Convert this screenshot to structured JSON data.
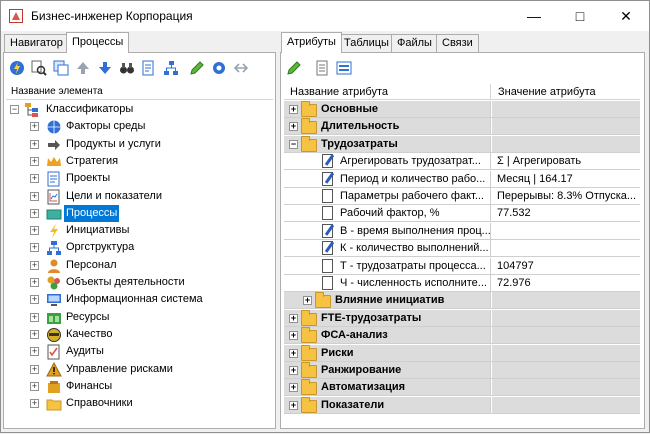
{
  "window": {
    "title": "Бизнес-инженер Корпорация"
  },
  "left_tabs": [
    {
      "label": "Навигатор",
      "active": false
    },
    {
      "label": "Процессы",
      "active": true
    }
  ],
  "right_tabs": [
    {
      "label": "Атрибуты",
      "active": true
    },
    {
      "label": "Таблицы",
      "active": false
    },
    {
      "label": "Файлы",
      "active": false
    },
    {
      "label": "Связи",
      "active": false
    }
  ],
  "tree": {
    "header": "Название элемента",
    "root": {
      "label": "Классификаторы",
      "icon": "hierarchy-icon"
    },
    "items": [
      {
        "label": "Факторы среды",
        "icon": "globe-icon",
        "color": "#2f6fd6"
      },
      {
        "label": "Продукты и услуги",
        "icon": "arrow-right-icon",
        "color": "#555555"
      },
      {
        "label": "Стратегия",
        "icon": "crown-icon",
        "color": "#f0a020"
      },
      {
        "label": "Проекты",
        "icon": "project-icon",
        "color": "#2f6fd6"
      },
      {
        "label": "Цели и показатели",
        "icon": "target-icon",
        "color": "#555555"
      },
      {
        "label": "Процессы",
        "icon": "process-icon",
        "color": "#3fb0a0",
        "selected": true
      },
      {
        "label": "Инициативы",
        "icon": "lightning-icon",
        "color": "#f0c020"
      },
      {
        "label": "Оргструктура",
        "icon": "org-chart-icon",
        "color": "#2f6fd6"
      },
      {
        "label": "Персонал",
        "icon": "person-icon",
        "color": "#e08a2a"
      },
      {
        "label": "Объекты деятельности",
        "icon": "objects-icon",
        "color": "#e0a020"
      },
      {
        "label": "Информационная система",
        "icon": "computer-icon",
        "color": "#2f6fd6"
      },
      {
        "label": "Ресурсы",
        "icon": "resources-icon",
        "color": "#3aa040"
      },
      {
        "label": "Качество",
        "icon": "quality-icon",
        "color": "#d6b020"
      },
      {
        "label": "Аудиты",
        "icon": "audit-icon",
        "color": "#555555"
      },
      {
        "label": "Управление рисками",
        "icon": "risk-icon",
        "color": "#e0a020"
      },
      {
        "label": "Финансы",
        "icon": "finance-icon",
        "color": "#e0a020"
      },
      {
        "label": "Справочники",
        "icon": "folder-icon",
        "color": "#f5c242"
      }
    ]
  },
  "grid": {
    "col1": "Название атрибута",
    "col2": "Значение атрибута",
    "rows": [
      {
        "kind": "group",
        "level": 0,
        "expanded": false,
        "label": "Основные",
        "value": ""
      },
      {
        "kind": "group",
        "level": 0,
        "expanded": false,
        "label": "Длительность",
        "value": ""
      },
      {
        "kind": "group",
        "level": 0,
        "expanded": true,
        "label": "Трудозатраты",
        "value": ""
      },
      {
        "kind": "attr",
        "level": 1,
        "icon": "edit-doc-icon",
        "label": "Агрегировать трудозатрат...",
        "value": "Σ  | Агрегировать"
      },
      {
        "kind": "attr",
        "level": 1,
        "icon": "edit-doc-icon",
        "label": "Период и количество рабо...",
        "value": "Месяц | 164.17"
      },
      {
        "kind": "attr",
        "level": 1,
        "icon": "doc-icon",
        "label": "Параметры рабочего факт...",
        "value": "Перерывы: 8.3%  Отпуска..."
      },
      {
        "kind": "attr",
        "level": 1,
        "icon": "doc-icon",
        "label": "Рабочий фактор, %",
        "value": "77.532"
      },
      {
        "kind": "attr",
        "level": 1,
        "icon": "edit-doc-icon",
        "label": "В - время выполнения проц...",
        "value": ""
      },
      {
        "kind": "attr",
        "level": 1,
        "icon": "edit-doc-icon",
        "label": "К - количество выполнений...",
        "value": ""
      },
      {
        "kind": "attr",
        "level": 1,
        "icon": "doc-icon",
        "label": "Т - трудозатраты процесса...",
        "value": "104797"
      },
      {
        "kind": "attr",
        "level": 1,
        "icon": "doc-icon",
        "label": "Ч - численность исполните...",
        "value": "72.976"
      },
      {
        "kind": "group",
        "level": 1,
        "expanded": false,
        "label": "Влияние инициатив",
        "value": ""
      },
      {
        "kind": "group",
        "level": 0,
        "expanded": false,
        "label": "FTE-трудозатраты",
        "value": ""
      },
      {
        "kind": "group",
        "level": 0,
        "expanded": false,
        "label": "ФСА-анализ",
        "value": ""
      },
      {
        "kind": "group",
        "level": 0,
        "expanded": false,
        "label": "Риски",
        "value": ""
      },
      {
        "kind": "group",
        "level": 0,
        "expanded": false,
        "label": "Ранжирование",
        "value": ""
      },
      {
        "kind": "group",
        "level": 0,
        "expanded": false,
        "label": "Автоматизация",
        "value": ""
      },
      {
        "kind": "group",
        "level": 0,
        "expanded": false,
        "label": "Показатели",
        "value": ""
      }
    ]
  },
  "left_toolbar": [
    "lightning-icon",
    "search-tree-icon",
    "copy-icon",
    "move-up-icon",
    "move-down-icon",
    "binoculars-icon",
    "filter-doc-icon",
    "tree-view-icon",
    "edit-icon",
    "settings-icon",
    "arrows-icon"
  ],
  "right_toolbar": [
    "edit-icon",
    "table-view-icon",
    "form-view-icon"
  ],
  "colors": {
    "selection": "#0078d7",
    "group_row": "#dcdcdc"
  }
}
